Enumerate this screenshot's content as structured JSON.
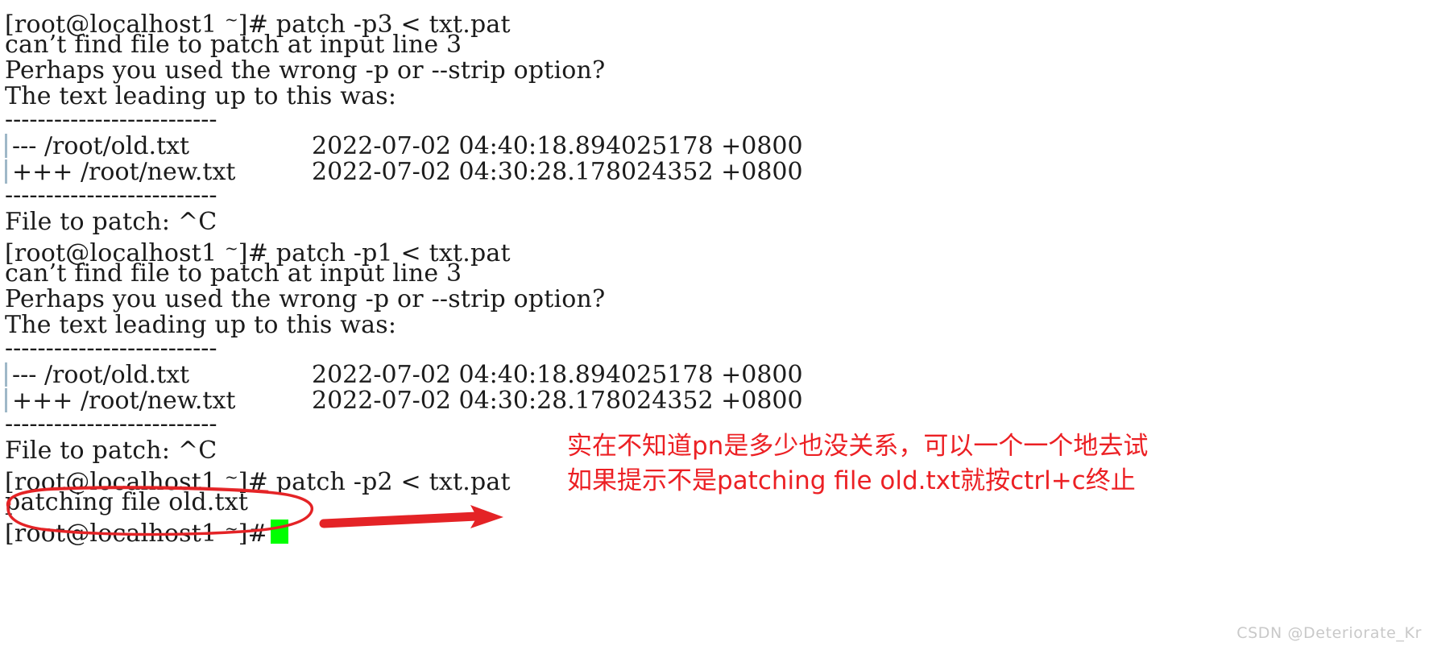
{
  "terminal": {
    "prompt": "[root@localhost1 ~]#",
    "prompt_head": "[root@localhost1 ",
    "prompt_tilde": "~",
    "prompt_tail": "]# ",
    "lines": [
      {
        "type": "prompt",
        "command": "patch -p3 < txt.pat"
      },
      {
        "type": "text",
        "text": "can’t find file to patch at input line 3"
      },
      {
        "type": "text",
        "text": "Perhaps you used the wrong -p or --strip option?"
      },
      {
        "type": "text",
        "text": "The text leading up to this was:"
      },
      {
        "type": "separator",
        "text": "--------------------------"
      },
      {
        "type": "diff",
        "marker": "--- /root/old.txt",
        "stamp": "2022-07-02 04:40:18.894025178 +0800"
      },
      {
        "type": "diff",
        "marker": "+++ /root/new.txt",
        "stamp": "2022-07-02 04:30:28.178024352 +0800"
      },
      {
        "type": "separator",
        "text": "--------------------------"
      },
      {
        "type": "text",
        "text": "File to patch: ^C"
      },
      {
        "type": "prompt",
        "command": "patch -p1 < txt.pat"
      },
      {
        "type": "text",
        "text": "can’t find file to patch at input line 3"
      },
      {
        "type": "text",
        "text": "Perhaps you used the wrong -p or --strip option?"
      },
      {
        "type": "text",
        "text": "The text leading up to this was:"
      },
      {
        "type": "separator",
        "text": "--------------------------"
      },
      {
        "type": "diff",
        "marker": "--- /root/old.txt",
        "stamp": "2022-07-02 04:40:18.894025178 +0800"
      },
      {
        "type": "diff",
        "marker": "+++ /root/new.txt",
        "stamp": "2022-07-02 04:30:28.178024352 +0800"
      },
      {
        "type": "separator",
        "text": "--------------------------"
      },
      {
        "type": "text",
        "text": "File to patch: ^C"
      },
      {
        "type": "prompt",
        "command": "patch -p2 < txt.pat"
      },
      {
        "type": "text",
        "text": "patching file old.txt"
      },
      {
        "type": "prompt",
        "command": ""
      }
    ],
    "cursor": {
      "name": "block-cursor",
      "color": "#00ff00"
    },
    "text_color": "#1b1b1b",
    "background_color": "#ffffff"
  },
  "annotations": {
    "color": "#ec2024",
    "note_line_1": "实在不知道pn是多少也没关系，可以一个一个地去试",
    "note_line_2": "如果提示不是patching file old.txt就按ctrl+c终止",
    "ellipse_target": "patching file old.txt",
    "arrow_name": "red-arrow-pointing-right"
  },
  "watermark": {
    "text": "CSDN @Deteriorate_Kr",
    "color": "#c9c9c9"
  }
}
